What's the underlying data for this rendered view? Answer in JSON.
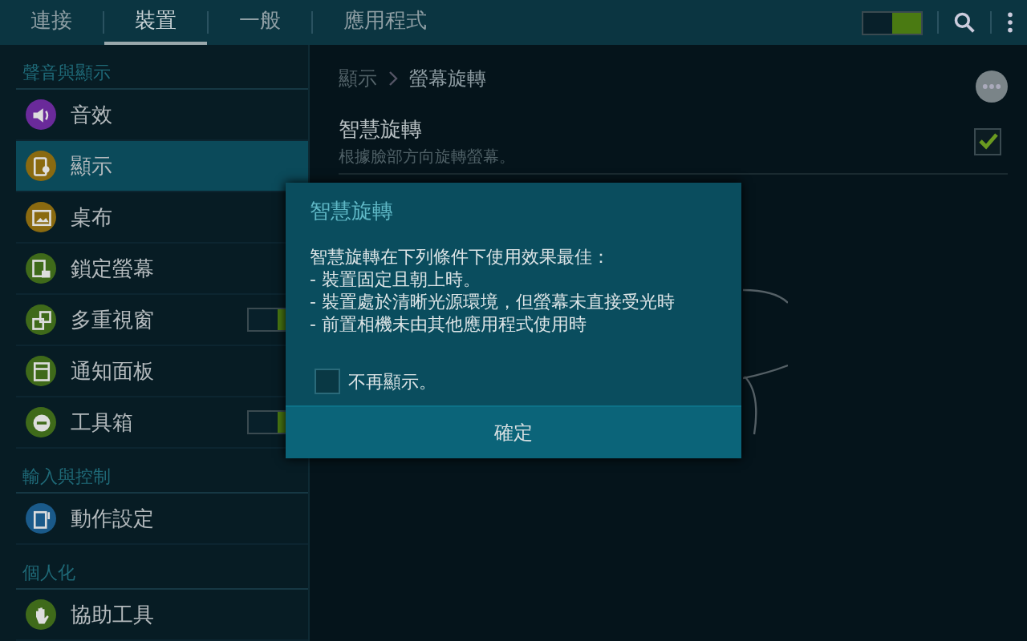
{
  "tabs": [
    {
      "label": "連接",
      "selected": false
    },
    {
      "label": "裝置",
      "selected": true
    },
    {
      "label": "一般",
      "selected": false
    },
    {
      "label": "應用程式",
      "selected": false
    }
  ],
  "master_switch": {
    "on": true
  },
  "sidebar": {
    "sections": [
      {
        "title": "聲音與顯示",
        "items": [
          {
            "label": "音效",
            "kind": "sound",
            "color": "#6a2a9a",
            "selected": false
          },
          {
            "label": "顯示",
            "kind": "display",
            "color": "#8a6a10",
            "selected": true
          },
          {
            "label": "桌布",
            "kind": "wallpaper",
            "color": "#8a6a10",
            "selected": false
          },
          {
            "label": "鎖定螢幕",
            "kind": "lock",
            "color": "#3f6a1a",
            "selected": false
          },
          {
            "label": "多重視窗",
            "kind": "windows",
            "color": "#3f6a1a",
            "selected": false,
            "switch_on": true
          },
          {
            "label": "通知面板",
            "kind": "panel",
            "color": "#3f6a1a",
            "selected": false
          },
          {
            "label": "工具箱",
            "kind": "toolbox",
            "color": "#3f6a1a",
            "selected": false,
            "switch_on": true
          }
        ]
      },
      {
        "title": "輸入與控制",
        "items": [
          {
            "label": "動作設定",
            "kind": "motion",
            "color": "#1a5a8a",
            "selected": false
          }
        ]
      },
      {
        "title": "個人化",
        "items": [
          {
            "label": "協助工具",
            "kind": "hand",
            "color": "#3f6a1a",
            "selected": false
          }
        ]
      }
    ]
  },
  "breadcrumb": [
    "顯示",
    "螢幕旋轉"
  ],
  "setting": {
    "title": "智慧旋轉",
    "subtitle": "根據臉部方向旋轉螢幕。",
    "checked": true
  },
  "dialog": {
    "title": "智慧旋轉",
    "body": [
      "智慧旋轉在下列條件下使用效果最佳：",
      "- 裝置固定且朝上時。",
      "- 裝置處於清晰光源環境，但螢幕未直接受光時",
      "- 前置相機未由其他應用程式使用時"
    ],
    "checkbox": {
      "label": "不再顯示。",
      "checked": false
    },
    "button": "確定"
  }
}
